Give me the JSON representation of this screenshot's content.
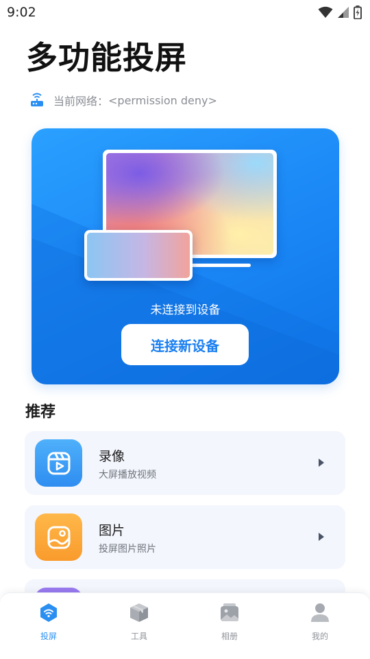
{
  "status_bar": {
    "time": "9:02"
  },
  "header": {
    "title": "多功能投屏",
    "network_label": "当前网络：",
    "network_value": "<permission deny>"
  },
  "hero": {
    "status_text": "未连接到设备",
    "connect_button": "连接新设备",
    "colors": {
      "primary": "#1a86f5",
      "button_text": "#1a7ff0"
    }
  },
  "recommend": {
    "section_title": "推荐",
    "items": [
      {
        "title": "录像",
        "subtitle": "大屏播放视频",
        "icon": "video-reel-icon",
        "color": "#3b9af5"
      },
      {
        "title": "图片",
        "subtitle": "投屏图片照片",
        "icon": "picture-icon",
        "color": "#fba63a"
      }
    ]
  },
  "bottom_nav": {
    "items": [
      {
        "label": "投屏",
        "icon": "wifi-cast-icon",
        "active": true
      },
      {
        "label": "工具",
        "icon": "toolbox-icon",
        "active": false
      },
      {
        "label": "相册",
        "icon": "album-icon",
        "active": false
      },
      {
        "label": "我的",
        "icon": "user-icon",
        "active": false
      }
    ],
    "active_color": "#2b8ff2"
  }
}
